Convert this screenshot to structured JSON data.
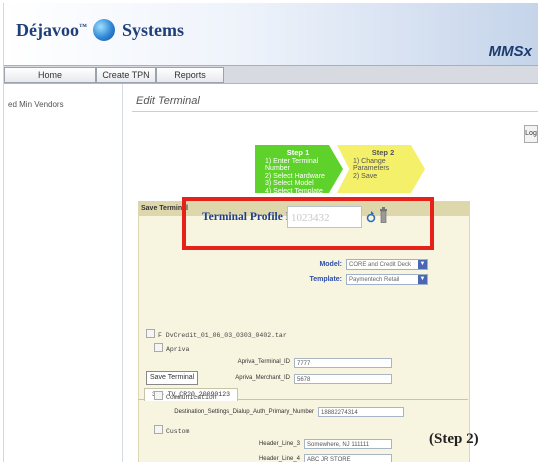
{
  "header": {
    "logo_text_left": "Déjavoo",
    "logo_text_right": "Systems",
    "product": "MMSx"
  },
  "nav": {
    "tabs": [
      "Home",
      "Create TPN",
      "Reports"
    ]
  },
  "sidebar": {
    "item": "ed Min Vendors"
  },
  "page": {
    "title": "Edit Terminal",
    "logout_label": "Log"
  },
  "steps": {
    "step1": {
      "title": "Step 1",
      "lines": [
        "1) Enter Terminal Number",
        "2) Select Hardware",
        "3) Select Model",
        "4) Select Template"
      ]
    },
    "step2": {
      "title": "Step 2",
      "lines": [
        "1) Change Parameters",
        "2) Save"
      ]
    }
  },
  "panel": {
    "header": "Save Terminal",
    "model_label": "Model:",
    "model_value": "CORE and Credit Deck",
    "template_label": "Template:",
    "template_value": "Paymentech Retail",
    "save_button": "Save Terminal",
    "file_tab": "316 TV_CR20_20090123"
  },
  "tree": {
    "root": "F DvCredit_01_06_03_0303_0402.tar",
    "apriva": "Apriva",
    "communication": "Communication",
    "custom": "Custom"
  },
  "params": {
    "terminal_id_label": "Apriva_Terminal_ID",
    "terminal_id_value": "7777",
    "merchant_id_label": "Apriva_Merchant_ID",
    "merchant_id_value": "5678",
    "dest_label": "Destination_Settings_Dialup_Auth_Primary_Number",
    "dest_value": "18882274314",
    "header3_label": "Header_Line_3",
    "header3_value": "Somewhere, NJ 111111",
    "header4_label": "Header_Line_4",
    "header4_value": "ABC JR STORE"
  },
  "highlight": {
    "label": "Terminal Profile Number",
    "value": "1023432"
  },
  "caption": "(Step 2)"
}
